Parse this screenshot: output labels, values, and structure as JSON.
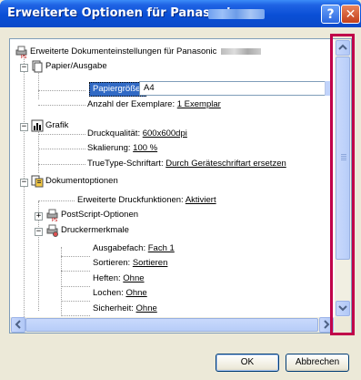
{
  "window": {
    "title": "Erweiterte Optionen für Panasonic",
    "help_label": "?",
    "close_label": "✕"
  },
  "tree": {
    "root": "Erweiterte Dokumenteinstellungen für Panasonic",
    "paper": {
      "label": "Papier/Ausgabe",
      "size_label": "Papiergröße:",
      "size_value": "A4",
      "copies_label": "Anzahl der Exemplare:",
      "copies_value": "1 Exemplar"
    },
    "graphic": {
      "label": "Grafik",
      "quality_label": "Druckqualität:",
      "quality_value": "600x600dpi",
      "scaling_label": "Skalierung:",
      "scaling_value": "100 %",
      "truetype_label": "TrueType-Schriftart:",
      "truetype_value": "Durch Geräteschriftart ersetzen"
    },
    "docoptions": {
      "label": "Dokumentoptionen",
      "advanced_label": "Erweiterte Druckfunktionen:",
      "advanced_value": "Aktiviert",
      "postscript_label": "PostScript-Optionen",
      "features_label": "Druckermerkmale",
      "output_label": "Ausgabefach:",
      "output_value": "Fach 1",
      "sort_label": "Sortieren:",
      "sort_value": "Sortieren",
      "staple_label": "Heften:",
      "staple_value": "Ohne",
      "punch_label": "Lochen:",
      "punch_value": "Ohne",
      "security_label": "Sicherheit:",
      "security_value": "Ohne"
    }
  },
  "buttons": {
    "ok": "OK",
    "cancel": "Abbrechen"
  }
}
